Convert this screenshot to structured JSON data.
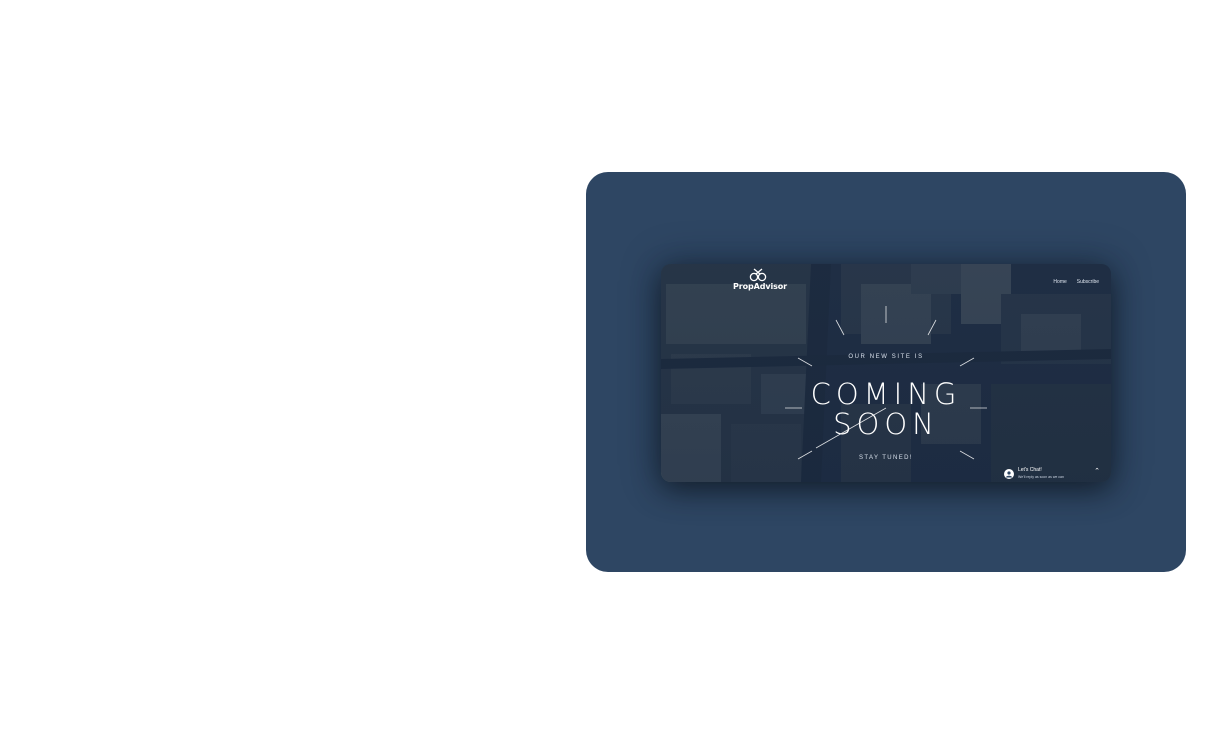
{
  "site": {
    "brand": "PropAdvisor",
    "logo_icon": "scissors-rings-icon"
  },
  "nav": {
    "items": [
      {
        "label": "Home"
      },
      {
        "label": "Subscribe"
      }
    ]
  },
  "hero": {
    "eyebrow": "OUR NEW SITE IS",
    "headline_line1": "COMING",
    "headline_line2": "SOON",
    "tagline": "STAY TUNED!"
  },
  "chat": {
    "title": "Let's Chat!",
    "subtitle": "We'll reply as soon as we can",
    "avatar_icon": "user-avatar-icon",
    "toggle_icon": "chevron-up-icon"
  },
  "colors": {
    "card_background": "#2e4663",
    "overlay": "#16243c",
    "text": "#ffffff"
  }
}
